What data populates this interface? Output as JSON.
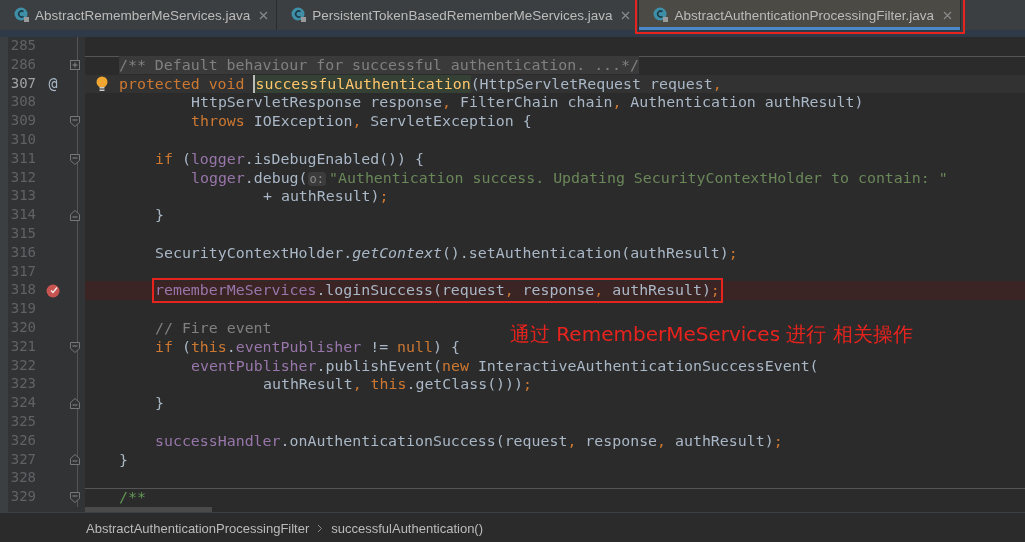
{
  "tabs": [
    {
      "label": "AbstractRememberMeServices.java",
      "selected": false,
      "boxed": false
    },
    {
      "label": "PersistentTokenBasedRememberMeServices.java",
      "selected": false,
      "boxed": false
    },
    {
      "label": "AbstractAuthenticationProcessingFilter.java",
      "selected": true,
      "boxed": true
    }
  ],
  "editor": {
    "lines": [
      {
        "number": "285"
      },
      {
        "number": "286",
        "collapsed": true,
        "separator": true,
        "tokens": [
          {
            "kind": "folded",
            "text": "/** Default behaviour for successful authentication. ...*/"
          }
        ]
      },
      {
        "number": "307",
        "marker": "@",
        "bulb": true,
        "current": true,
        "tokens": [
          {
            "kind": "kw",
            "text": "protected void "
          },
          {
            "kind": "decl",
            "text": "successfulAuthentication"
          },
          {
            "kind": "plain",
            "text": "(HttpServletRequest request"
          },
          {
            "kind": "kw",
            "text": ","
          }
        ],
        "children": [
          {
            "number": "308",
            "kind": "continuation",
            "tokens": [
              {
                "kind": "plain",
                "text": "HttpServletResponse response"
              },
              {
                "kind": "kw",
                "text": ","
              },
              {
                "kind": "plain",
                "text": " FilterChain chain"
              },
              {
                "kind": "kw",
                "text": ","
              },
              {
                "kind": "plain",
                "text": " Authentication authResult)"
              }
            ]
          },
          {
            "number": "309",
            "kind": "continuation",
            "fold_start": true,
            "tokens": [
              {
                "kind": "kw",
                "text": "throws"
              },
              {
                "kind": "plain",
                "text": " IOException"
              },
              {
                "kind": "kw",
                "text": ","
              },
              {
                "kind": "plain",
                "text": " ServletException {"
              }
            ]
          },
          {
            "number": "310",
            "kind": "statement"
          },
          {
            "number": "311",
            "kind": "statement",
            "fold_start": true,
            "tokens": [
              {
                "kind": "kw",
                "text": "if"
              },
              {
                "kind": "plain",
                "text": " ("
              },
              {
                "kind": "field",
                "text": "logger"
              },
              {
                "kind": "plain",
                "text": ".isDebugEnabled()) {"
              }
            ],
            "children": [
              {
                "number": "312",
                "kind": "statement",
                "tokens": [
                  {
                    "kind": "field",
                    "text": "logger"
                  },
                  {
                    "kind": "plain",
                    "text": ".debug("
                  },
                  {
                    "kind": "hint",
                    "text": "o:"
                  },
                  {
                    "kind": "str",
                    "text": "\"Authentication success. Updating SecurityContextHolder to contain: \""
                  }
                ],
                "children": [
                  {
                    "number": "313",
                    "kind": "continuation",
                    "tokens": [
                      {
                        "kind": "plain",
                        "text": "+ authResult)"
                      },
                      {
                        "kind": "kw",
                        "text": ";"
                      }
                    ]
                  }
                ]
              }
            ]
          },
          {
            "number": "314",
            "kind": "statement",
            "fold_end": true,
            "tokens": [
              {
                "kind": "plain",
                "text": "}"
              }
            ]
          },
          {
            "number": "315",
            "kind": "statement"
          },
          {
            "number": "316",
            "kind": "statement",
            "tokens": [
              {
                "kind": "plain",
                "text": "SecurityContextHolder."
              },
              {
                "kind": "italic",
                "text": "getContext"
              },
              {
                "kind": "plain",
                "text": "().setAuthentication(authResult)"
              },
              {
                "kind": "kw",
                "text": ";"
              }
            ]
          },
          {
            "number": "317",
            "kind": "statement"
          },
          {
            "number": "318",
            "kind": "statement",
            "breakpoint": true,
            "boxed": true,
            "tokens": [
              {
                "kind": "field",
                "text": "rememberMeServices"
              },
              {
                "kind": "plain",
                "text": ".loginSuccess(request"
              },
              {
                "kind": "kw",
                "text": ","
              },
              {
                "kind": "plain",
                "text": " response"
              },
              {
                "kind": "kw",
                "text": ","
              },
              {
                "kind": "plain",
                "text": " authResult)"
              },
              {
                "kind": "kw",
                "text": ";"
              }
            ]
          },
          {
            "number": "319",
            "kind": "statement"
          },
          {
            "number": "320",
            "kind": "statement",
            "tokens": [
              {
                "kind": "comment",
                "text": "// Fire event"
              }
            ]
          },
          {
            "number": "321",
            "kind": "statement",
            "fold_start": true,
            "tokens": [
              {
                "kind": "kw",
                "text": "if"
              },
              {
                "kind": "plain",
                "text": " ("
              },
              {
                "kind": "kw",
                "text": "this"
              },
              {
                "kind": "plain",
                "text": "."
              },
              {
                "kind": "field",
                "text": "eventPublisher"
              },
              {
                "kind": "plain",
                "text": " != "
              },
              {
                "kind": "kw",
                "text": "null"
              },
              {
                "kind": "plain",
                "text": ") {"
              }
            ],
            "children": [
              {
                "number": "322",
                "kind": "statement",
                "tokens": [
                  {
                    "kind": "field",
                    "text": "eventPublisher"
                  },
                  {
                    "kind": "plain",
                    "text": ".publishEvent("
                  },
                  {
                    "kind": "kw",
                    "text": "new"
                  },
                  {
                    "kind": "plain",
                    "text": " InteractiveAuthenticationSuccessEvent("
                  }
                ],
                "children": [
                  {
                    "number": "323",
                    "kind": "continuation",
                    "tokens": [
                      {
                        "kind": "plain",
                        "text": "authResult"
                      },
                      {
                        "kind": "kw",
                        "text": ", this"
                      },
                      {
                        "kind": "plain",
                        "text": ".getClass()))"
                      },
                      {
                        "kind": "kw",
                        "text": ";"
                      }
                    ]
                  }
                ]
              }
            ]
          },
          {
            "number": "324",
            "kind": "statement",
            "fold_end": true,
            "tokens": [
              {
                "kind": "plain",
                "text": "}"
              }
            ]
          },
          {
            "number": "325",
            "kind": "statement"
          },
          {
            "number": "326",
            "kind": "statement",
            "tokens": [
              {
                "kind": "field",
                "text": "successHandler"
              },
              {
                "kind": "plain",
                "text": ".onAuthenticationSuccess(request"
              },
              {
                "kind": "kw",
                "text": ","
              },
              {
                "kind": "plain",
                "text": " response"
              },
              {
                "kind": "kw",
                "text": ","
              },
              {
                "kind": "plain",
                "text": " authResult)"
              },
              {
                "kind": "kw",
                "text": ";"
              }
            ]
          }
        ]
      },
      {
        "number": "327",
        "fold_end": true,
        "tokens": [
          {
            "kind": "plain",
            "text": "}"
          }
        ]
      },
      {
        "number": "328"
      },
      {
        "number": "329",
        "fold_start": true,
        "separator": true,
        "tokens": [
          {
            "kind": "doc",
            "text": "/**"
          }
        ]
      }
    ]
  },
  "annotation": {
    "text": "通过 RememberMeServices 进行 相关操作"
  },
  "breadcrumb": [
    "AbstractAuthenticationProcessingFilter",
    "successfulAuthentication()"
  ]
}
